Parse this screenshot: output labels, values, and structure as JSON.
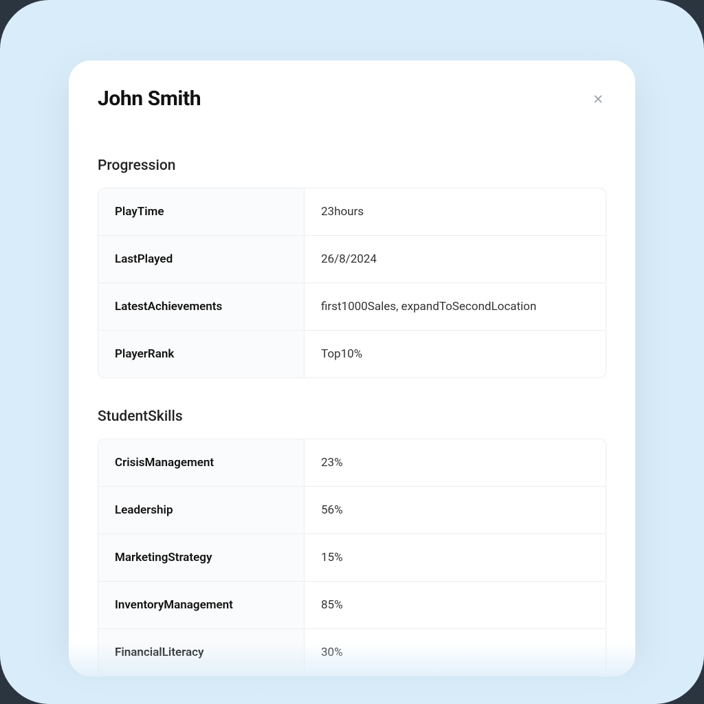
{
  "modal": {
    "title": "John Smith"
  },
  "sections": {
    "progression": {
      "title": "Progression",
      "rows": [
        {
          "label": "PlayTime",
          "value": "23hours"
        },
        {
          "label": "LastPlayed",
          "value": "26/8/2024"
        },
        {
          "label": "LatestAchievements",
          "value": "first1000Sales, expandToSecondLocation"
        },
        {
          "label": "PlayerRank",
          "value": "Top10%"
        }
      ]
    },
    "studentSkills": {
      "title": "StudentSkills",
      "rows": [
        {
          "label": "CrisisManagement",
          "value": "23%"
        },
        {
          "label": "Leadership",
          "value": "56%"
        },
        {
          "label": "MarketingStrategy",
          "value": "15%"
        },
        {
          "label": "InventoryManagement",
          "value": "85%"
        },
        {
          "label": "FinancialLiteracy",
          "value": "30%"
        }
      ]
    }
  }
}
